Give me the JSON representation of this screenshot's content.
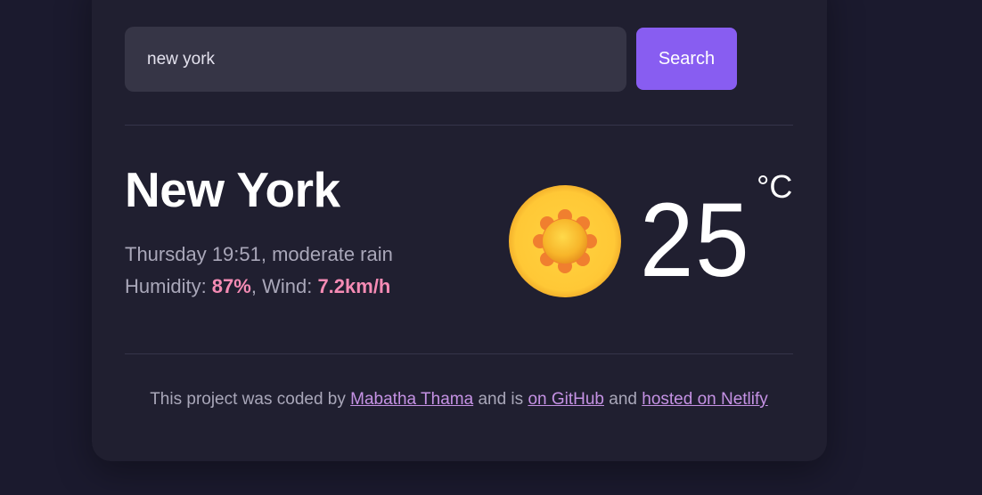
{
  "search": {
    "value": "new york",
    "button_label": "Search"
  },
  "weather": {
    "city": "New York",
    "day_time": "Thursday 19:51",
    "description": "moderate rain",
    "humidity_label": "Humidity: ",
    "humidity_value": "87%",
    "wind_label": "Wind: ",
    "wind_value": "7.2km/h",
    "temperature": "25",
    "unit": "°C",
    "icon": "sun-icon"
  },
  "footer": {
    "text_1": "This project was coded by ",
    "author_link": "Mabatha Thama",
    "text_2": " and is ",
    "github_link": "on GitHub",
    "text_3": " and ",
    "netlify_link": "hosted on Netlify"
  },
  "colors": {
    "background": "#1b1a2e",
    "card": "#201f30",
    "accent": "#885df1",
    "highlight": "#f58bb4",
    "link": "#c592e4"
  }
}
